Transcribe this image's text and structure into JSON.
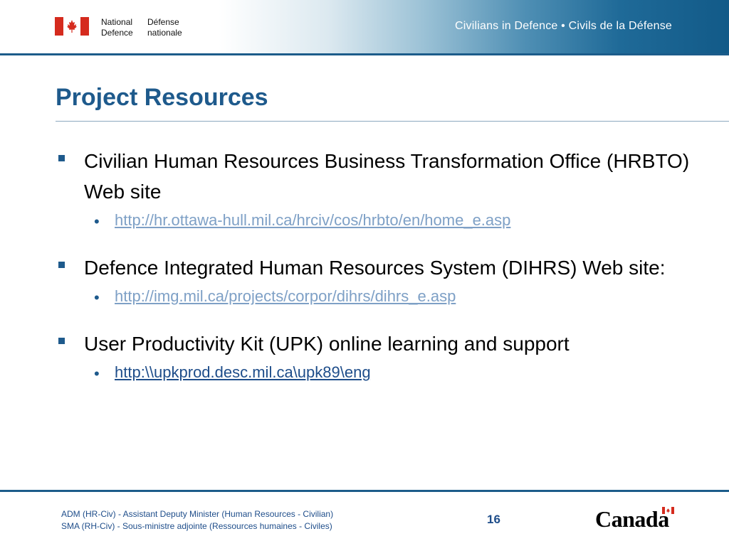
{
  "header": {
    "signature_en": [
      "National",
      "Defence"
    ],
    "signature_fr": [
      "Défense",
      "nationale"
    ],
    "tagline": "Civilians in Defence • Civils de la Défense"
  },
  "slide": {
    "title": "Project Resources",
    "items": [
      {
        "text": "Civilian Human Resources Business Transformation Office (HRBTO) Web site",
        "link": "http://hr.ottawa-hull.mil.ca/hrciv/cos/hrbto/en/home_e.asp"
      },
      {
        "text": "Defence Integrated Human Resources System (DIHRS) Web site:",
        "link": "http://img.mil.ca/projects/corpor/dihrs/dihrs_e.asp"
      },
      {
        "text": "User Productivity Kit (UPK) online learning and support",
        "link": "http:\\\\upkprod.desc.mil.ca\\upk89\\eng"
      }
    ]
  },
  "footer": {
    "line1": "ADM (HR-Civ) - Assistant Deputy Minister (Human Resources - Civilian)",
    "line2": "SMA (RH-Civ) - Sous-ministre adjointe (Ressources humaines - Civiles)",
    "page_number": "16",
    "wordmark": "Canada"
  },
  "colors": {
    "primary_blue": "#1e5a8c",
    "header_dark": "#125a88",
    "flag_red": "#d52b1e",
    "link_muted": "#7ea0c6",
    "link_dark": "#1e4d8a"
  }
}
